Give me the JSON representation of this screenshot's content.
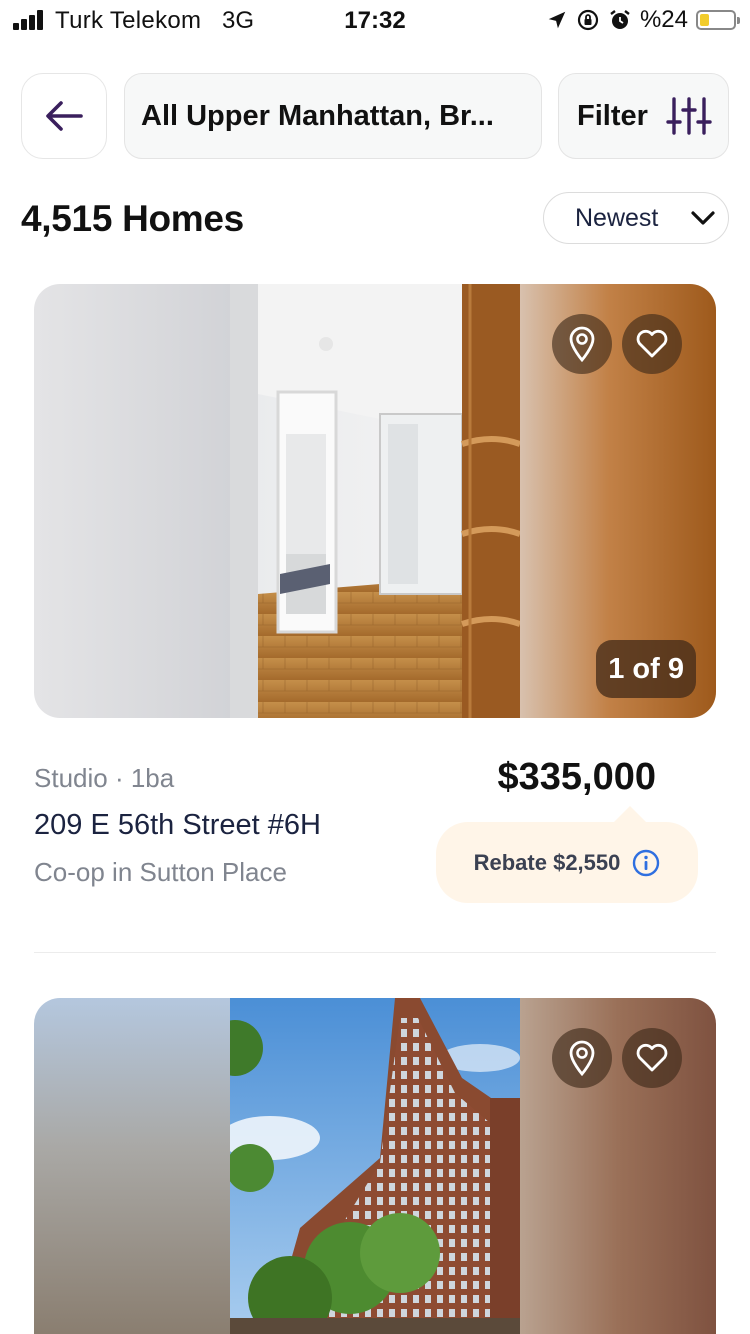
{
  "status_bar": {
    "carrier": "Turk Telekom",
    "network": "3G",
    "time": "17:32",
    "battery_percent": "%24",
    "battery_level": 0.24,
    "icons": [
      "location-arrow-icon",
      "rotation-lock-icon",
      "alarm-icon"
    ]
  },
  "header": {
    "back_icon": "arrow-left-icon",
    "search_text": "All Upper Manhattan, Br...",
    "filter_label": "Filter",
    "filter_icon": "sliders-icon"
  },
  "results": {
    "count_label": "4,515 Homes",
    "sort_label": "Newest",
    "sort_icon": "chevron-down-icon"
  },
  "listings": [
    {
      "photo_counter": "1 of 9",
      "meta": "Studio · 1ba",
      "address": "209 E 56th Street #6H",
      "type": "Co-op in Sutton Place",
      "price": "$335,000",
      "rebate": "Rebate $2,550",
      "photo_description": "interior hallway with parquet floor"
    },
    {
      "photo_description": "brick high-rise apartment building exterior"
    }
  ],
  "colors": {
    "accent_purple": "#3a1f5d",
    "rebate_bg": "#fff5e8",
    "info_blue": "#2f6fe0",
    "text_navy": "#1b2340",
    "text_gray": "#80858f"
  }
}
